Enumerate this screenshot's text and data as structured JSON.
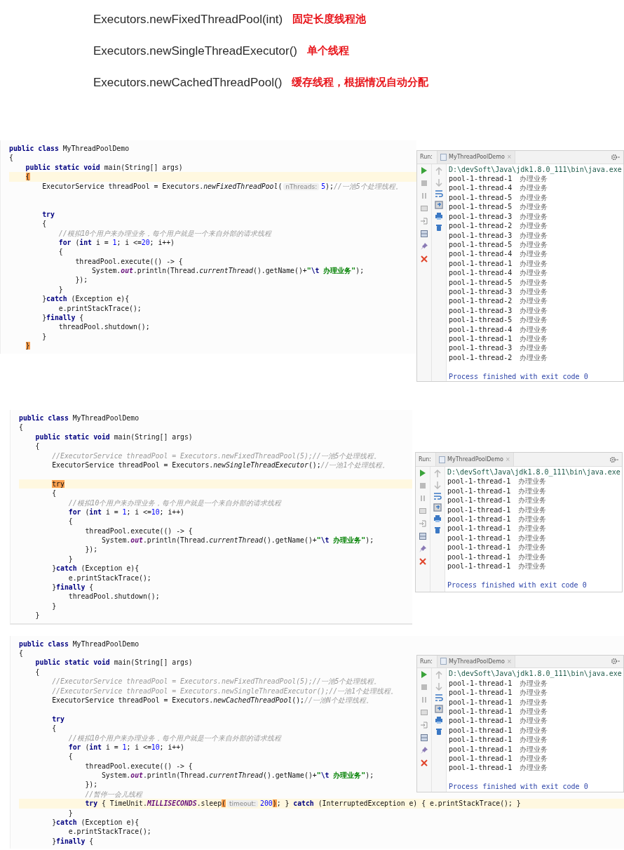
{
  "api_list": [
    {
      "signature": "Executors.newFixedThreadPool(int)",
      "description": "固定长度线程池"
    },
    {
      "signature": "Executors.newSingleThreadExecutor()",
      "description": "单个线程"
    },
    {
      "signature": "Executors.newCachedThreadPool()",
      "description": "缓存线程，根据情况自动分配"
    }
  ],
  "examples": [
    {
      "code": {
        "lines": [
          {
            "highlighted": false,
            "tokens": [
              {
                "kind": "keyword",
                "text": "public class "
              },
              {
                "kind": "plain",
                "text": "MyThreadPoolDemo"
              }
            ]
          },
          {
            "highlighted": false,
            "tokens": [
              {
                "kind": "plain",
                "text": "{"
              }
            ]
          },
          {
            "highlighted": false,
            "tokens": [
              {
                "kind": "keyword",
                "text": "    public static void "
              },
              {
                "kind": "plain",
                "text": "main(String[] args)"
              }
            ]
          },
          {
            "highlighted": true,
            "tokens": [
              {
                "kind": "match",
                "text": "    {"
              }
            ]
          },
          {
            "highlighted": false,
            "tokens": [
              {
                "kind": "plain",
                "text": "        ExecutorService threadPool = Executors."
              },
              {
                "kind": "method",
                "text": "newFixedThreadPool"
              },
              {
                "kind": "plain",
                "text": "("
              },
              {
                "kind": "hint",
                "text": "nThreads:"
              },
              {
                "kind": "number",
                "text": "5"
              },
              {
                "kind": "plain",
                "text": ");"
              },
              {
                "kind": "comment",
                "text": "//一池5个处理线程。"
              }
            ]
          },
          {
            "highlighted": false
          },
          {
            "highlighted": false
          },
          {
            "highlighted": false,
            "tokens": [
              {
                "kind": "keyword",
                "text": "        try"
              }
            ]
          },
          {
            "highlighted": false,
            "tokens": [
              {
                "kind": "plain",
                "text": "        {"
              }
            ]
          },
          {
            "highlighted": false,
            "tokens": [
              {
                "kind": "comment",
                "text": "            //模拟10个用户来办理业务，每个用户就是一个来自外部的请求线程"
              }
            ]
          },
          {
            "highlighted": false,
            "tokens": [
              {
                "kind": "keyword",
                "text": "            for"
              },
              {
                "kind": "plain",
                "text": " ("
              },
              {
                "kind": "keyword",
                "text": "int"
              },
              {
                "kind": "plain",
                "text": " i = "
              },
              {
                "kind": "number",
                "text": "1"
              },
              {
                "kind": "plain",
                "text": "; i <="
              },
              {
                "kind": "number",
                "text": "20"
              },
              {
                "kind": "plain",
                "text": "; i++)"
              }
            ]
          },
          {
            "highlighted": false,
            "tokens": [
              {
                "kind": "plain",
                "text": "            {"
              }
            ]
          },
          {
            "highlighted": false,
            "tokens": [
              {
                "kind": "plain",
                "text": "                threadPool.execute(() -> {"
              }
            ]
          },
          {
            "highlighted": false,
            "tokens": [
              {
                "kind": "plain",
                "text": "                    System."
              },
              {
                "kind": "field",
                "text": "out"
              },
              {
                "kind": "plain",
                "text": ".println(Thread."
              },
              {
                "kind": "method",
                "text": "currentThread"
              },
              {
                "kind": "plain",
                "text": "().getName()+"
              },
              {
                "kind": "string",
                "text": "\""
              },
              {
                "kind": "escape",
                "text": "\\t"
              },
              {
                "kind": "string",
                "text": " 办理业务\""
              },
              {
                "kind": "plain",
                "text": ");"
              }
            ]
          },
          {
            "highlighted": false,
            "tokens": [
              {
                "kind": "plain",
                "text": "                });"
              }
            ]
          },
          {
            "highlighted": false,
            "tokens": [
              {
                "kind": "plain",
                "text": "            }"
              }
            ]
          },
          {
            "highlighted": false,
            "tokens": [
              {
                "kind": "plain",
                "text": "        }"
              },
              {
                "kind": "keyword",
                "text": "catch"
              },
              {
                "kind": "plain",
                "text": " (Exception e){"
              }
            ]
          },
          {
            "highlighted": false,
            "tokens": [
              {
                "kind": "plain",
                "text": "            e.printStackTrace();"
              }
            ]
          },
          {
            "highlighted": false,
            "tokens": [
              {
                "kind": "plain",
                "text": "        }"
              },
              {
                "kind": "keyword",
                "text": "finally"
              },
              {
                "kind": "plain",
                "text": " {"
              }
            ]
          },
          {
            "highlighted": false,
            "tokens": [
              {
                "kind": "plain",
                "text": "            threadPool.shutdown();"
              }
            ]
          },
          {
            "highlighted": false,
            "tokens": [
              {
                "kind": "plain",
                "text": "        }"
              }
            ]
          },
          {
            "highlighted": false,
            "tokens": [
              {
                "kind": "match",
                "text": "    }"
              }
            ]
          }
        ]
      },
      "console": {
        "label": "Run:",
        "tab": "MyThreadPoolDemo",
        "tab_close": "×",
        "scroll_to_end_on": true,
        "command": "D:\\devSoft\\Java\\jdk1.8.0_111\\bin\\java.exe",
        "output": [
          {
            "thread": "pool-1-thread-1",
            "message": "办理业务"
          },
          {
            "thread": "pool-1-thread-4",
            "message": "办理业务"
          },
          {
            "thread": "pool-1-thread-5",
            "message": "办理业务"
          },
          {
            "thread": "pool-1-thread-5",
            "message": "办理业务"
          },
          {
            "thread": "pool-1-thread-3",
            "message": "办理业务"
          },
          {
            "thread": "pool-1-thread-2",
            "message": "办理业务"
          },
          {
            "thread": "pool-1-thread-3",
            "message": "办理业务"
          },
          {
            "thread": "pool-1-thread-5",
            "message": "办理业务"
          },
          {
            "thread": "pool-1-thread-4",
            "message": "办理业务"
          },
          {
            "thread": "pool-1-thread-1",
            "message": "办理业务"
          },
          {
            "thread": "pool-1-thread-4",
            "message": "办理业务"
          },
          {
            "thread": "pool-1-thread-5",
            "message": "办理业务"
          },
          {
            "thread": "pool-1-thread-3",
            "message": "办理业务"
          },
          {
            "thread": "pool-1-thread-2",
            "message": "办理业务"
          },
          {
            "thread": "pool-1-thread-3",
            "message": "办理业务"
          },
          {
            "thread": "pool-1-thread-5",
            "message": "办理业务"
          },
          {
            "thread": "pool-1-thread-4",
            "message": "办理业务"
          },
          {
            "thread": "pool-1-thread-1",
            "message": "办理业务"
          },
          {
            "thread": "pool-1-thread-3",
            "message": "办理业务"
          },
          {
            "thread": "pool-1-thread-2",
            "message": "办理业务"
          }
        ],
        "exit": "Process finished with exit code 0"
      }
    },
    {
      "code": {
        "lines": [
          {
            "highlighted": false,
            "tokens": [
              {
                "kind": "keyword",
                "text": "public class "
              },
              {
                "kind": "plain",
                "text": "MyThreadPoolDemo"
              }
            ]
          },
          {
            "highlighted": false,
            "tokens": [
              {
                "kind": "plain",
                "text": "{"
              }
            ]
          },
          {
            "highlighted": false,
            "tokens": [
              {
                "kind": "keyword",
                "text": "    public static void "
              },
              {
                "kind": "plain",
                "text": "main(String[] args)"
              }
            ]
          },
          {
            "highlighted": false,
            "tokens": [
              {
                "kind": "plain",
                "text": "    {"
              }
            ]
          },
          {
            "highlighted": false,
            "tokens": [
              {
                "kind": "comment",
                "text": "        //ExecutorService threadPool = Executors.newFixedThreadPool(5);//一池5个处理线程。"
              }
            ]
          },
          {
            "highlighted": false,
            "tokens": [
              {
                "kind": "plain",
                "text": "        ExecutorService threadPool = Executors."
              },
              {
                "kind": "method",
                "text": "newSingleThreadExecutor"
              },
              {
                "kind": "plain",
                "text": "();"
              },
              {
                "kind": "comment",
                "text": "//一池1个处理线程。"
              }
            ]
          },
          {
            "highlighted": false
          },
          {
            "highlighted": true,
            "tokens": [
              {
                "kind": "match",
                "text": "        try"
              }
            ]
          },
          {
            "highlighted": false,
            "tokens": [
              {
                "kind": "plain",
                "text": "        {"
              }
            ]
          },
          {
            "highlighted": false,
            "tokens": [
              {
                "kind": "comment",
                "text": "            //模拟10个用户来办理业务，每个用户就是一个来自外部的请求线程"
              }
            ]
          },
          {
            "highlighted": false,
            "tokens": [
              {
                "kind": "keyword",
                "text": "            for"
              },
              {
                "kind": "plain",
                "text": " ("
              },
              {
                "kind": "keyword",
                "text": "int"
              },
              {
                "kind": "plain",
                "text": " i = "
              },
              {
                "kind": "number",
                "text": "1"
              },
              {
                "kind": "plain",
                "text": "; i <="
              },
              {
                "kind": "number",
                "text": "10"
              },
              {
                "kind": "plain",
                "text": "; i++)"
              }
            ]
          },
          {
            "highlighted": false,
            "tokens": [
              {
                "kind": "plain",
                "text": "            {"
              }
            ]
          },
          {
            "highlighted": false,
            "tokens": [
              {
                "kind": "plain",
                "text": "                threadPool.execute(() -> {"
              }
            ]
          },
          {
            "highlighted": false,
            "tokens": [
              {
                "kind": "plain",
                "text": "                    System."
              },
              {
                "kind": "field",
                "text": "out"
              },
              {
                "kind": "plain",
                "text": ".println(Thread."
              },
              {
                "kind": "method",
                "text": "currentThread"
              },
              {
                "kind": "plain",
                "text": "().getName()+"
              },
              {
                "kind": "string",
                "text": "\""
              },
              {
                "kind": "escape",
                "text": "\\t"
              },
              {
                "kind": "string",
                "text": " 办理业务\""
              },
              {
                "kind": "plain",
                "text": ");"
              }
            ]
          },
          {
            "highlighted": false,
            "tokens": [
              {
                "kind": "plain",
                "text": "                });"
              }
            ]
          },
          {
            "highlighted": false,
            "tokens": [
              {
                "kind": "plain",
                "text": "            }"
              }
            ]
          },
          {
            "highlighted": false,
            "tokens": [
              {
                "kind": "plain",
                "text": "        }"
              },
              {
                "kind": "keyword",
                "text": "catch"
              },
              {
                "kind": "plain",
                "text": " (Exception e){"
              }
            ]
          },
          {
            "highlighted": false,
            "tokens": [
              {
                "kind": "plain",
                "text": "            e.printStackTrace();"
              }
            ]
          },
          {
            "highlighted": false,
            "tokens": [
              {
                "kind": "plain",
                "text": "        }"
              },
              {
                "kind": "keyword",
                "text": "finally"
              },
              {
                "kind": "plain",
                "text": " {"
              }
            ]
          },
          {
            "highlighted": false,
            "tokens": [
              {
                "kind": "plain",
                "text": "            threadPool.shutdown();"
              }
            ]
          },
          {
            "highlighted": false,
            "tokens": [
              {
                "kind": "plain",
                "text": "        }"
              }
            ]
          },
          {
            "highlighted": false,
            "tokens": [
              {
                "kind": "plain",
                "text": "    }"
              }
            ]
          }
        ]
      },
      "console": {
        "label": "Run:",
        "tab": "MyThreadPoolDemo",
        "tab_close": "×",
        "scroll_to_end_on": true,
        "command": "D:\\devSoft\\Java\\jdk1.8.0_111\\bin\\java.exe",
        "output": [
          {
            "thread": "pool-1-thread-1",
            "message": "办理业务"
          },
          {
            "thread": "pool-1-thread-1",
            "message": "办理业务"
          },
          {
            "thread": "pool-1-thread-1",
            "message": "办理业务"
          },
          {
            "thread": "pool-1-thread-1",
            "message": "办理业务"
          },
          {
            "thread": "pool-1-thread-1",
            "message": "办理业务"
          },
          {
            "thread": "pool-1-thread-1",
            "message": "办理业务"
          },
          {
            "thread": "pool-1-thread-1",
            "message": "办理业务"
          },
          {
            "thread": "pool-1-thread-1",
            "message": "办理业务"
          },
          {
            "thread": "pool-1-thread-1",
            "message": "办理业务"
          },
          {
            "thread": "pool-1-thread-1",
            "message": "办理业务"
          }
        ],
        "exit": "Process finished with exit code 0"
      }
    },
    {
      "code": {
        "lines": [
          {
            "highlighted": false,
            "tokens": [
              {
                "kind": "keyword",
                "text": "public class "
              },
              {
                "kind": "plain",
                "text": "MyThreadPoolDemo"
              }
            ]
          },
          {
            "highlighted": false,
            "tokens": [
              {
                "kind": "plain",
                "text": "{"
              }
            ]
          },
          {
            "highlighted": false,
            "tokens": [
              {
                "kind": "keyword",
                "text": "    public static void "
              },
              {
                "kind": "plain",
                "text": "main(String[] args)"
              }
            ]
          },
          {
            "highlighted": false,
            "tokens": [
              {
                "kind": "plain",
                "text": "    {"
              }
            ]
          },
          {
            "highlighted": false,
            "tokens": [
              {
                "kind": "comment",
                "text": "        //ExecutorService threadPool = Executors.newFixedThreadPool(5);//一池5个处理线程。"
              }
            ]
          },
          {
            "highlighted": false,
            "tokens": [
              {
                "kind": "comment",
                "text": "        //ExecutorService threadPool = Executors.newSingleThreadExecutor();//一池1个处理线程。"
              }
            ]
          },
          {
            "highlighted": false,
            "tokens": [
              {
                "kind": "plain",
                "text": "        ExecutorService threadPool = Executors."
              },
              {
                "kind": "method",
                "text": "newCachedThreadPool"
              },
              {
                "kind": "plain",
                "text": "();"
              },
              {
                "kind": "comment",
                "text": "//一池N个处理线程。"
              }
            ]
          },
          {
            "highlighted": false
          },
          {
            "highlighted": false,
            "tokens": [
              {
                "kind": "keyword",
                "text": "        try"
              }
            ]
          },
          {
            "highlighted": false,
            "tokens": [
              {
                "kind": "plain",
                "text": "        {"
              }
            ]
          },
          {
            "highlighted": false,
            "tokens": [
              {
                "kind": "comment",
                "text": "            //模拟10个用户来办理业务，每个用户就是一个来自外部的请求线程"
              }
            ]
          },
          {
            "highlighted": false,
            "tokens": [
              {
                "kind": "keyword",
                "text": "            for"
              },
              {
                "kind": "plain",
                "text": " ("
              },
              {
                "kind": "keyword",
                "text": "int"
              },
              {
                "kind": "plain",
                "text": " i = "
              },
              {
                "kind": "number",
                "text": "1"
              },
              {
                "kind": "plain",
                "text": "; i <="
              },
              {
                "kind": "number",
                "text": "10"
              },
              {
                "kind": "plain",
                "text": "; i++)"
              }
            ]
          },
          {
            "highlighted": false,
            "tokens": [
              {
                "kind": "plain",
                "text": "            {"
              }
            ]
          },
          {
            "highlighted": false,
            "tokens": [
              {
                "kind": "plain",
                "text": "                threadPool.execute(() -> {"
              }
            ]
          },
          {
            "highlighted": false,
            "tokens": [
              {
                "kind": "plain",
                "text": "                    System."
              },
              {
                "kind": "field",
                "text": "out"
              },
              {
                "kind": "plain",
                "text": ".println(Thread."
              },
              {
                "kind": "method",
                "text": "currentThread"
              },
              {
                "kind": "plain",
                "text": "().getName()+"
              },
              {
                "kind": "string",
                "text": "\""
              },
              {
                "kind": "escape",
                "text": "\\t"
              },
              {
                "kind": "string",
                "text": " 办理业务\""
              },
              {
                "kind": "plain",
                "text": ");"
              }
            ]
          },
          {
            "highlighted": false,
            "tokens": [
              {
                "kind": "plain",
                "text": "                });"
              }
            ]
          },
          {
            "highlighted": false,
            "tokens": [
              {
                "kind": "comment",
                "text": "                //暂停一会儿线程"
              }
            ]
          },
          {
            "highlighted": true,
            "tokens": [
              {
                "kind": "keyword",
                "text": "                try"
              },
              {
                "kind": "plain",
                "text": " { TimeUnit."
              },
              {
                "kind": "constant",
                "text": "MILLISECONDS"
              },
              {
                "kind": "plain",
                "text": ".sleep"
              },
              {
                "kind": "match",
                "text": "("
              },
              {
                "kind": "hint",
                "text": "timeout:"
              },
              {
                "kind": "number",
                "text": "200"
              },
              {
                "kind": "match",
                "text": ")"
              },
              {
                "kind": "plain",
                "text": "; } "
              },
              {
                "kind": "keyword",
                "text": "catch"
              },
              {
                "kind": "plain",
                "text": " (InterruptedException e) { e.printStackTrace(); }"
              }
            ]
          },
          {
            "highlighted": false,
            "tokens": [
              {
                "kind": "plain",
                "text": "            }"
              }
            ]
          },
          {
            "highlighted": false,
            "tokens": [
              {
                "kind": "plain",
                "text": "        }"
              },
              {
                "kind": "keyword",
                "text": "catch"
              },
              {
                "kind": "plain",
                "text": " (Exception e){"
              }
            ]
          },
          {
            "highlighted": false,
            "tokens": [
              {
                "kind": "plain",
                "text": "            e.printStackTrace();"
              }
            ]
          },
          {
            "highlighted": false,
            "tokens": [
              {
                "kind": "plain",
                "text": "        }"
              },
              {
                "kind": "keyword",
                "text": "finally"
              },
              {
                "kind": "plain",
                "text": " {"
              }
            ]
          }
        ]
      },
      "console": {
        "label": "Run:",
        "tab": "MyThreadPoolDemo",
        "tab_close": "×",
        "scroll_to_end_on": true,
        "command": "D:\\devSoft\\Java\\jdk1.8.0_111\\bin\\java.exe",
        "output": [
          {
            "thread": "pool-1-thread-1",
            "message": "办理业务"
          },
          {
            "thread": "pool-1-thread-1",
            "message": "办理业务"
          },
          {
            "thread": "pool-1-thread-1",
            "message": "办理业务"
          },
          {
            "thread": "pool-1-thread-1",
            "message": "办理业务"
          },
          {
            "thread": "pool-1-thread-1",
            "message": "办理业务"
          },
          {
            "thread": "pool-1-thread-1",
            "message": "办理业务"
          },
          {
            "thread": "pool-1-thread-1",
            "message": "办理业务"
          },
          {
            "thread": "pool-1-thread-1",
            "message": "办理业务"
          },
          {
            "thread": "pool-1-thread-1",
            "message": "办理业务"
          },
          {
            "thread": "pool-1-thread-1",
            "message": "办理业务"
          }
        ],
        "exit": "Process finished with exit code 0"
      }
    }
  ]
}
